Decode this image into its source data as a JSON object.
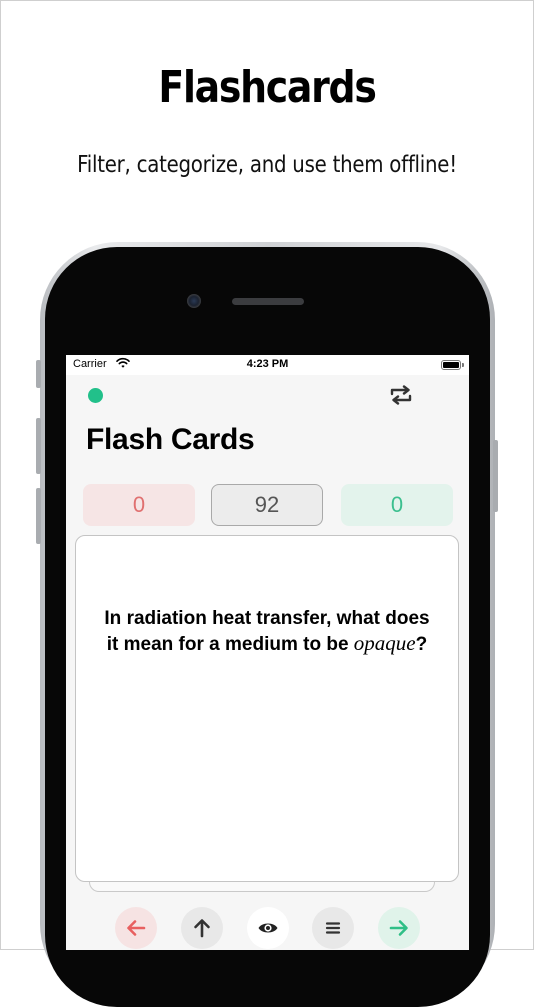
{
  "promo": {
    "headline": "Flashcards",
    "subheadline": "Filter, categorize, and use them offline!"
  },
  "status_bar": {
    "carrier": "Carrier",
    "time": "4:23 PM"
  },
  "app": {
    "title": "Flash Cards",
    "status_color": "#22c08a",
    "counters": {
      "wrong": "0",
      "remaining": "92",
      "correct": "0"
    },
    "card": {
      "question_before": "In radiation heat transfer, what does it mean for a medium to be",
      "question_emphasis": "opaque",
      "question_after": "?"
    },
    "actions": [
      {
        "icon": "arrow-left-icon",
        "color": "#e86060"
      },
      {
        "icon": "arrow-up-icon",
        "color": "#333333"
      },
      {
        "icon": "eye-icon",
        "color": "#222222"
      },
      {
        "icon": "list-icon",
        "color": "#333333"
      },
      {
        "icon": "arrow-right-icon",
        "color": "#2fbf87"
      }
    ]
  }
}
